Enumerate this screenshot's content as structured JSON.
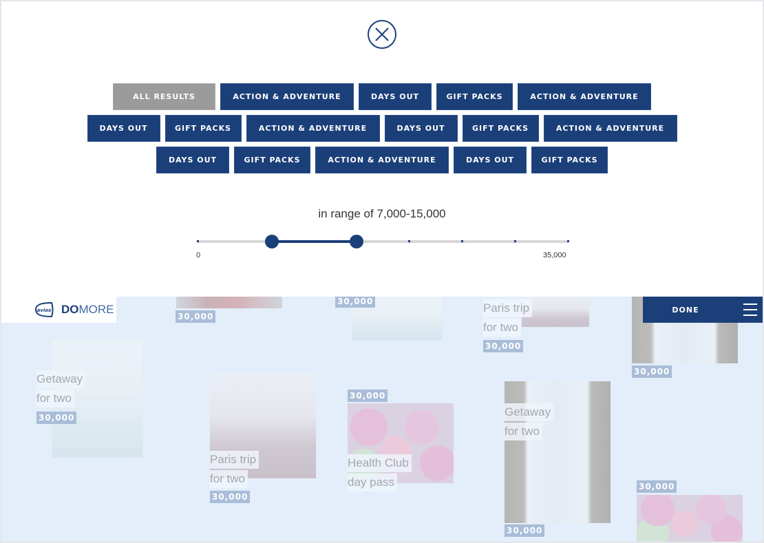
{
  "overlay": {
    "close_icon": "close-circle-icon",
    "filters": {
      "rows": [
        [
          {
            "label": "ALL RESULTS",
            "active": true
          },
          {
            "label": "ACTION & ADVENTURE",
            "active": false
          },
          {
            "label": "DAYS OUT",
            "active": false
          },
          {
            "label": "GIFT PACKS",
            "active": false
          },
          {
            "label": "ACTION & ADVENTURE",
            "active": false
          }
        ],
        [
          {
            "label": "DAYS OUT",
            "active": false
          },
          {
            "label": "GIFT PACKS",
            "active": false
          },
          {
            "label": "ACTION & ADVENTURE",
            "active": false
          },
          {
            "label": "DAYS OUT",
            "active": false
          },
          {
            "label": "GIFT PACKS",
            "active": false
          },
          {
            "label": "ACTION & ADVENTURE",
            "active": false
          }
        ],
        [
          {
            "label": "DAYS OUT",
            "active": false
          },
          {
            "label": "GIFT PACKS",
            "active": false
          },
          {
            "label": "ACTION & ADVENTURE",
            "active": false
          },
          {
            "label": "DAYS OUT",
            "active": false
          },
          {
            "label": "GIFT PACKS",
            "active": false
          }
        ]
      ]
    },
    "range": {
      "label": "in range of 7,000-15,000",
      "min": 0,
      "max": 35000,
      "min_label": "0",
      "max_label": "35,000",
      "low": 7000,
      "high": 15000,
      "tick_values": [
        0,
        20000,
        25000,
        30000,
        35000
      ]
    }
  },
  "header": {
    "logo_badge": "avios",
    "logo_bold": "DO",
    "logo_thin": "MORE",
    "done_label": "DONE",
    "menu_icon": "hamburger-menu-icon"
  },
  "cards": [
    {
      "price": "30,000",
      "title": []
    },
    {
      "price": "30,000",
      "title": []
    },
    {
      "price": "30,000",
      "title": [
        "Paris trip",
        "for two"
      ]
    },
    {
      "price": "30,000",
      "title": []
    },
    {
      "price": "30,000",
      "title": [
        "Getaway",
        "for two"
      ]
    },
    {
      "price": "30,000",
      "title": [
        "Paris trip",
        "for two"
      ]
    },
    {
      "price": "30,000",
      "title": [
        "Health Club",
        "day pass"
      ]
    },
    {
      "price": "30,000",
      "title": [
        "Getaway",
        "for two"
      ]
    },
    {
      "price": "30,000",
      "title": []
    }
  ],
  "colors": {
    "brand_navy": "#1b3f78",
    "chip_active": "#9b9b9b",
    "content_bg": "#e3eefa",
    "price_tag": "#a9bdd8"
  }
}
